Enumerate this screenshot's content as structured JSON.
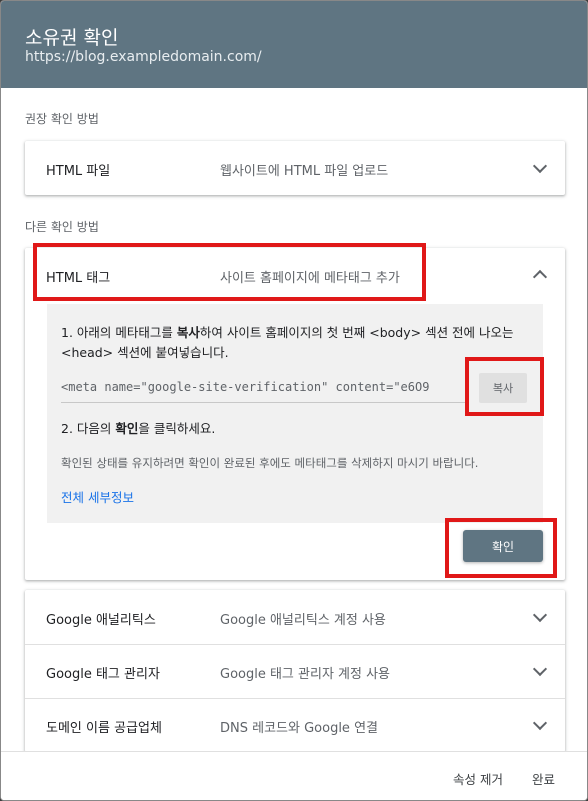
{
  "dialog": {
    "title": "소유권 확인",
    "url": "https://blog.exampledomain.com/"
  },
  "recommended_label": "권장 확인 방법",
  "other_label": "다른 확인 방법",
  "methods": {
    "html_file": {
      "name": "HTML 파일",
      "desc": "웹사이트에 HTML 파일 업로드"
    },
    "html_tag": {
      "name": "HTML 태그",
      "desc": "사이트 홈페이지에 메타태그 추가"
    },
    "ga": {
      "name": "Google 애널리틱스",
      "desc": "Google 애널리틱스 계정 사용"
    },
    "gtm": {
      "name": "Google 태그 관리자",
      "desc": "Google 태그 관리자 계정 사용"
    },
    "dns": {
      "name": "도메인 이름 공급업체",
      "desc": "DNS 레코드와 Google 연결"
    }
  },
  "panel": {
    "step1_prefix": "1. 아래의 메타태그를 ",
    "step1_bold": "복사",
    "step1_suffix": "하여 사이트 홈페이지의 첫 번째 <body> 섹션 전에 나오는",
    "step1_line2": "<head> 섹션에 붙여넣습니다.",
    "meta_value": "<meta name=\"google-site-verification\" content=\"e6O9",
    "copy_label": "복사",
    "step2_prefix": "2. 다음의 ",
    "step2_bold": "확인",
    "step2_suffix": "을 클릭하세요.",
    "note": "확인된 상태를 유지하려면 확인이 완료된 후에도 메타태그를 삭제하지 마시기 바랍니다.",
    "details_link": "전체 세부정보"
  },
  "confirm_label": "확인",
  "footer": {
    "remove_label": "속성 제거",
    "done_label": "완료"
  },
  "colors": {
    "header_bg": "#5f7582",
    "highlight": "#e01818",
    "link": "#1a73e8"
  }
}
